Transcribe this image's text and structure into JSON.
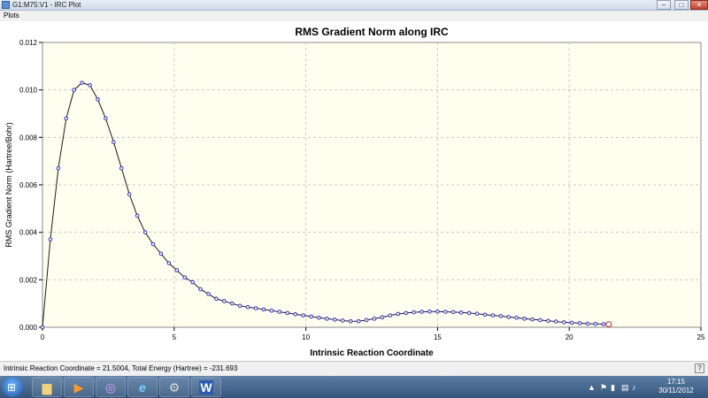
{
  "window": {
    "title": "G1:M75:V1 - IRC Plot",
    "min": "–",
    "max": "□",
    "close": "✕"
  },
  "menu": {
    "items": [
      "Plots"
    ]
  },
  "colors": {
    "line": "#1a1a1a",
    "marker_stroke": "#2b2bd0",
    "endpoint": "#d02020",
    "plot_bg": "#fffff0",
    "grid": "#c8c8c8"
  },
  "chart_data": {
    "type": "line",
    "title": "RMS Gradient Norm along IRC",
    "xlabel": "Intrinsic Reaction Coordinate",
    "ylabel": "RMS Gradient Norm (Hartree/Bohr)",
    "xlim": [
      0,
      25
    ],
    "ylim": [
      0,
      0.012
    ],
    "xticks": [
      "0",
      "5",
      "10",
      "15",
      "20",
      "25"
    ],
    "yticks": [
      "0.000",
      "0.002",
      "0.004",
      "0.006",
      "0.008",
      "0.010",
      "0.012"
    ],
    "grid": true,
    "x": [
      0,
      0.3,
      0.6,
      0.9,
      1.2,
      1.5,
      1.8,
      2.1,
      2.4,
      2.7,
      3.0,
      3.3,
      3.6,
      3.9,
      4.2,
      4.5,
      4.8,
      5.1,
      5.4,
      5.7,
      6.0,
      6.3,
      6.6,
      6.9,
      7.2,
      7.5,
      7.8,
      8.1,
      8.4,
      8.7,
      9.0,
      9.3,
      9.6,
      9.9,
      10.2,
      10.5,
      10.8,
      11.1,
      11.4,
      11.7,
      12.0,
      12.3,
      12.6,
      12.9,
      13.2,
      13.5,
      13.8,
      14.1,
      14.4,
      14.7,
      15.0,
      15.3,
      15.6,
      15.9,
      16.2,
      16.5,
      16.8,
      17.1,
      17.4,
      17.7,
      18.0,
      18.3,
      18.6,
      18.9,
      19.2,
      19.5,
      19.8,
      20.1,
      20.4,
      20.7,
      21.0,
      21.3,
      21.5
    ],
    "y": [
      0.0,
      0.0037,
      0.0067,
      0.0088,
      0.01,
      0.0103,
      0.0102,
      0.0096,
      0.0088,
      0.0078,
      0.0067,
      0.0056,
      0.0047,
      0.004,
      0.0035,
      0.0031,
      0.0027,
      0.0024,
      0.0021,
      0.0019,
      0.0016,
      0.0014,
      0.0012,
      0.0011,
      0.001,
      0.0009,
      0.00085,
      0.0008,
      0.00075,
      0.0007,
      0.00065,
      0.0006,
      0.00055,
      0.0005,
      0.00045,
      0.0004,
      0.00036,
      0.00032,
      0.00028,
      0.00025,
      0.00025,
      0.0003,
      0.00036,
      0.00042,
      0.0005,
      0.00056,
      0.0006,
      0.00063,
      0.00065,
      0.00066,
      0.00066,
      0.00065,
      0.00064,
      0.00062,
      0.0006,
      0.00057,
      0.00053,
      0.0005,
      0.00047,
      0.00043,
      0.0004,
      0.00036,
      0.00033,
      0.0003,
      0.00027,
      0.00024,
      0.00021,
      0.00019,
      0.00017,
      0.00015,
      0.00014,
      0.00013,
      0.00012
    ]
  },
  "status": {
    "text": "Intrinsic Reaction Coordinate = 21.5004, Total Energy (Hartree) = -231.693",
    "help": "?"
  },
  "taskbar": {
    "start": "⊞",
    "apps": [
      {
        "name": "explorer-icon",
        "glyph": "▆"
      },
      {
        "name": "media-player-icon",
        "glyph": "▶"
      },
      {
        "name": "gaussview-icon",
        "glyph": "◎"
      },
      {
        "name": "internet-explorer-icon",
        "glyph": "e"
      },
      {
        "name": "app-settings-icon",
        "glyph": "⚙"
      },
      {
        "name": "word-icon",
        "glyph": "W"
      }
    ],
    "clock_time": "17:15",
    "clock_date": "30/11/2012"
  }
}
